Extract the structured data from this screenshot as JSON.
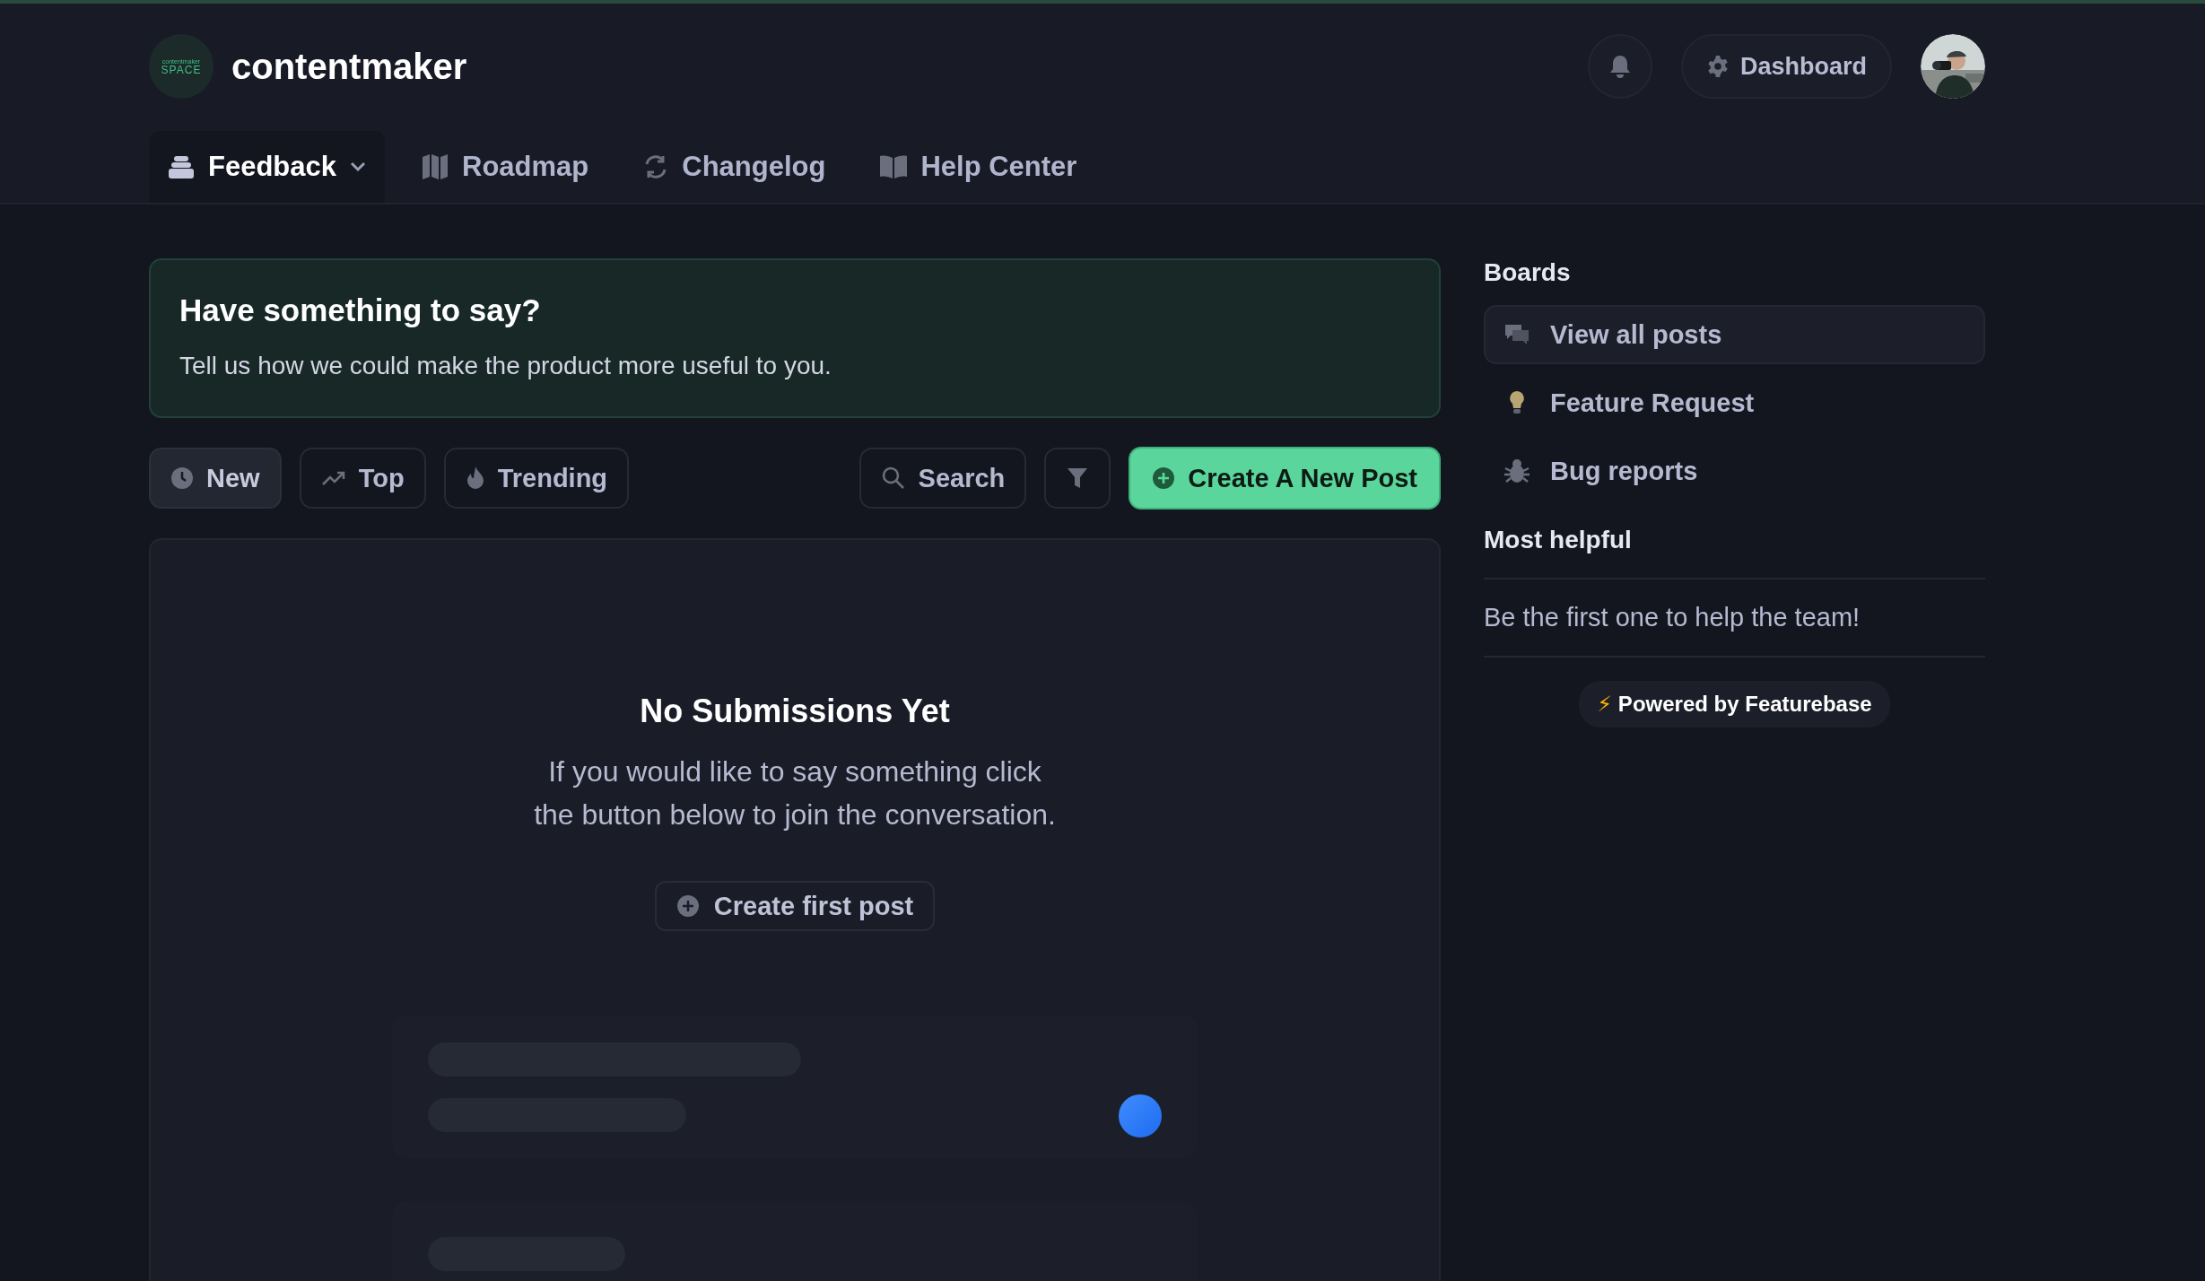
{
  "header": {
    "logo_text": [
      "contentmaker",
      "SPACE"
    ],
    "brand": "contentmaker",
    "dashboard_button": "Dashboard",
    "avatar": {
      "kind": "picture"
    }
  },
  "nav_tabs": [
    {
      "label": "Feedback",
      "selected": true,
      "has_dropdown": true
    },
    {
      "label": "Roadmap",
      "selected": false,
      "has_dropdown": false
    },
    {
      "label": "Changelog",
      "selected": false,
      "has_dropdown": false
    },
    {
      "label": "Help Center",
      "selected": false,
      "has_dropdown": false
    }
  ],
  "banner": {
    "title": "Have something to say?",
    "text": "Tell us how we could make the product more useful to you."
  },
  "sort_buttons": [
    {
      "label": "New",
      "selected": true
    },
    {
      "label": "Top",
      "selected": false
    },
    {
      "label": "Trending",
      "selected": false
    }
  ],
  "search_button": "Search",
  "create_button": "Create A New Post",
  "empty_state": {
    "title": "No Submissions Yet",
    "lines": [
      "If you would like to say something click",
      "the button below to join the conversation."
    ],
    "button": "Create first post"
  },
  "sidebar": {
    "boards_title": "Boards",
    "boards": [
      {
        "label": "View all posts",
        "selected": true
      },
      {
        "label": "Feature Request",
        "selected": false
      },
      {
        "label": "Bug reports",
        "selected": false
      }
    ],
    "most_helpful_title": "Most helpful",
    "most_helpful_text": "Be the first one to help the team!",
    "powered_by": "Powered by Featurebase",
    "powered_icon": "⚡"
  }
}
